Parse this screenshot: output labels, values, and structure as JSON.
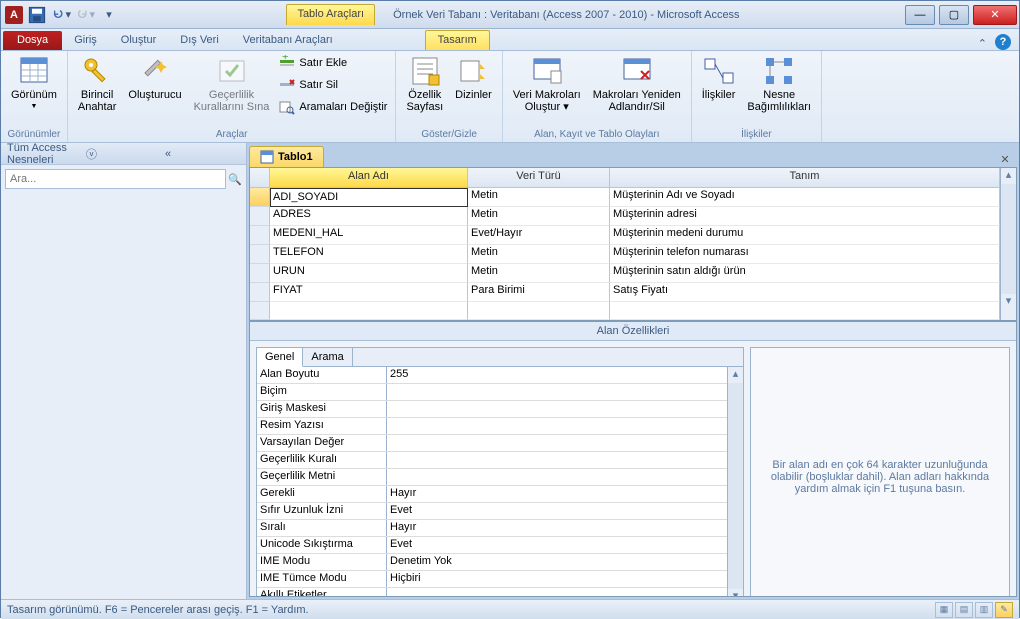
{
  "titlebar": {
    "table_tools": "Tablo Araçları",
    "title": "Örnek Veri Tabanı : Veritabanı (Access 2007 - 2010)  -  Microsoft Access"
  },
  "menu": {
    "file": "Dosya",
    "home": "Giriş",
    "create": "Oluştur",
    "external": "Dış Veri",
    "dbtools": "Veritabanı Araçları",
    "design": "Tasarım"
  },
  "ribbon": {
    "view": "Görünüm",
    "views_group": "Görünümler",
    "primary_key": "Birincil\nAnahtar",
    "builder": "Oluşturucu",
    "test_rules": "Geçerlilik\nKurallarını Sına",
    "insert_rows": "Satır Ekle",
    "delete_rows": "Satır Sil",
    "modify_lookups": "Aramaları Değiştir",
    "tools_group": "Araçlar",
    "property_sheet": "Özellik\nSayfası",
    "indexes": "Dizinler",
    "showhide_group": "Göster/Gizle",
    "create_macros": "Veri Makroları\nOluştur ▾",
    "rename_macro": "Makroları Yeniden\nAdlandır/Sil",
    "events_group": "Alan, Kayıt ve Tablo Olayları",
    "relationships": "İlişkiler",
    "deps": "Nesne\nBağımlılıkları",
    "relations_group": "İlişkiler"
  },
  "nav": {
    "header": "Tüm Access Nesneleri",
    "search_placeholder": "Ara..."
  },
  "doc": {
    "tab": "Tablo1"
  },
  "grid": {
    "col_field": "Alan Adı",
    "col_type": "Veri Türü",
    "col_desc": "Tanım",
    "rows": [
      {
        "field": "ADI_SOYADI",
        "type": "Metin",
        "desc": "Müşterinin Adı ve Soyadı"
      },
      {
        "field": "ADRES",
        "type": "Metin",
        "desc": "Müşterinin adresi"
      },
      {
        "field": "MEDENI_HAL",
        "type": "Evet/Hayır",
        "desc": "Müşterinin medeni durumu"
      },
      {
        "field": "TELEFON",
        "type": "Metin",
        "desc": "Müşterinin telefon numarası"
      },
      {
        "field": "URUN",
        "type": "Metin",
        "desc": "Müşterinin satın aldığı ürün"
      },
      {
        "field": "FIYAT",
        "type": "Para Birimi",
        "desc": "Satış Fiyatı"
      }
    ]
  },
  "splitter_label": "Alan Özellikleri",
  "props": {
    "tab_general": "Genel",
    "tab_lookup": "Arama",
    "rows": [
      {
        "name": "Alan Boyutu",
        "val": "255"
      },
      {
        "name": "Biçim",
        "val": ""
      },
      {
        "name": "Giriş Maskesi",
        "val": ""
      },
      {
        "name": "Resim Yazısı",
        "val": ""
      },
      {
        "name": "Varsayılan Değer",
        "val": ""
      },
      {
        "name": "Geçerlilik Kuralı",
        "val": ""
      },
      {
        "name": "Geçerlilik Metni",
        "val": ""
      },
      {
        "name": "Gerekli",
        "val": "Hayır"
      },
      {
        "name": "Sıfır Uzunluk İzni",
        "val": "Evet"
      },
      {
        "name": "Sıralı",
        "val": "Hayır"
      },
      {
        "name": "Unicode Sıkıştırma",
        "val": "Evet"
      },
      {
        "name": "IME Modu",
        "val": "Denetim Yok"
      },
      {
        "name": "IME Tümce Modu",
        "val": "Hiçbiri"
      },
      {
        "name": "Akıllı Etiketler",
        "val": ""
      }
    ],
    "help": "Bir alan adı en çok 64 karakter uzunluğunda olabilir (boşluklar dahil). Alan adları hakkında yardım almak için F1 tuşuna basın."
  },
  "status": {
    "text": "Tasarım görünümü.  F6 = Pencereler arası geçiş.  F1 = Yardım."
  }
}
